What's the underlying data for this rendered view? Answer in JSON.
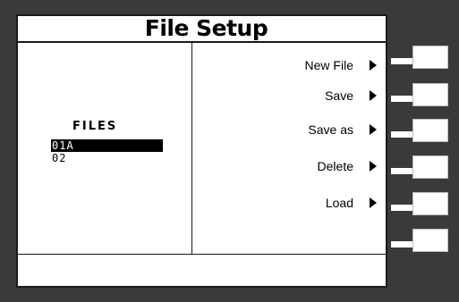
{
  "screen": {
    "title": "File Setup"
  },
  "files_panel": {
    "header": "FILES",
    "items": [
      {
        "label": "01A",
        "selected": true
      },
      {
        "label": "02",
        "selected": false
      }
    ]
  },
  "menu": {
    "items": [
      {
        "label": "New File",
        "icon": "right-arrow-icon"
      },
      {
        "label": "Save",
        "icon": "right-arrow-icon"
      },
      {
        "label": "Save as",
        "icon": "right-arrow-icon"
      },
      {
        "label": "Delete",
        "icon": "right-arrow-icon"
      },
      {
        "label": "Load",
        "icon": "right-arrow-icon"
      }
    ]
  },
  "status_bar": {
    "text": ""
  },
  "softkeys": {
    "count": 6
  },
  "colors": {
    "bezel": "#3a3a3a",
    "screen_bg": "#ffffff",
    "text": "#000000",
    "selection_bg": "#000000",
    "selection_text": "#ffffff"
  }
}
